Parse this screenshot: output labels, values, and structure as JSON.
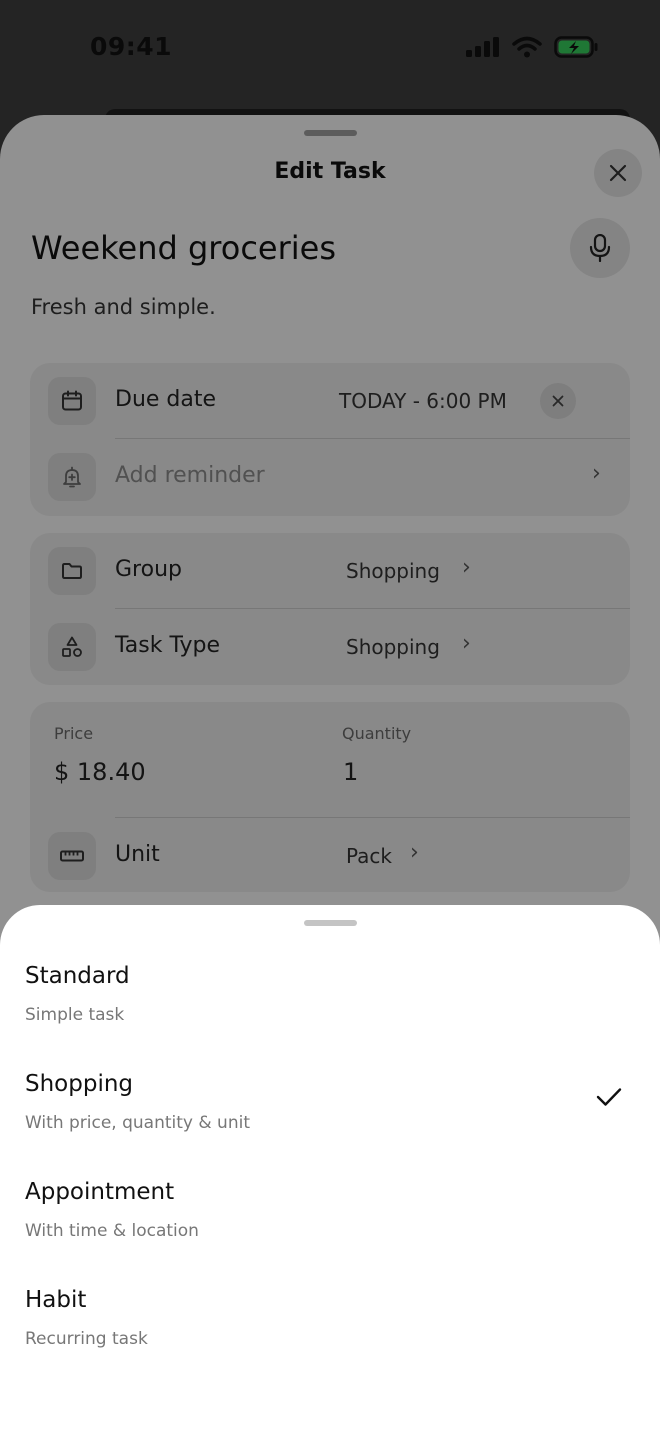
{
  "status_bar": {
    "time": "09:41",
    "icons": [
      "cellular-signal-icon",
      "wifi-icon",
      "battery-charging-icon"
    ],
    "battery_color": "#34c759"
  },
  "edit_task": {
    "title": "Edit Task",
    "task_name": "Weekend groceries",
    "description": "Fresh and simple.",
    "due_date": {
      "label": "Due date",
      "value": "TODAY - 6:00 PM"
    },
    "reminder": {
      "label": "Add reminder"
    },
    "group": {
      "label": "Group",
      "value": "Shopping"
    },
    "task_type": {
      "label": "Task Type",
      "value": "Shopping"
    },
    "price": {
      "label": "Price",
      "value": "$ 18.40"
    },
    "quantity": {
      "label": "Quantity",
      "value": "1"
    },
    "unit": {
      "label": "Unit",
      "value": "Pack"
    }
  },
  "task_type_picker": {
    "options": [
      {
        "title": "Standard",
        "subtitle": "Simple task",
        "selected": false
      },
      {
        "title": "Shopping",
        "subtitle": "With price, quantity & unit",
        "selected": true
      },
      {
        "title": "Appointment",
        "subtitle": "With time & location",
        "selected": false
      },
      {
        "title": "Habit",
        "subtitle": "Recurring task",
        "selected": false
      }
    ]
  }
}
